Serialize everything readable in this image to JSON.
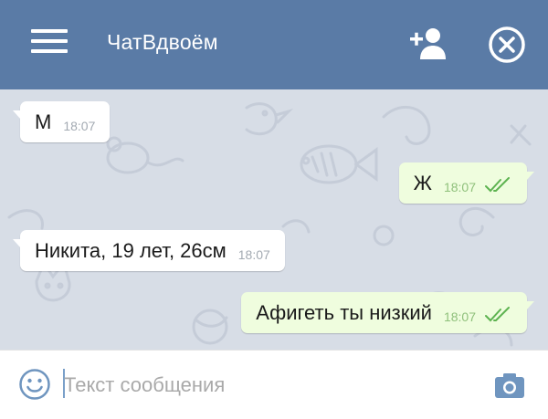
{
  "header": {
    "title": "ЧатВдвоём",
    "menu_icon": "hamburger-menu-icon",
    "add_user_icon": "add-user-icon",
    "close_icon": "close-circle-icon",
    "bg_color": "#5a7ba6"
  },
  "messages": [
    {
      "direction": "in",
      "text": "М",
      "time": "18:07"
    },
    {
      "direction": "out",
      "text": "Ж",
      "time": "18:07",
      "status": "read"
    },
    {
      "direction": "in",
      "text": "Никита, 19 лет, 26см",
      "time": "18:07"
    },
    {
      "direction": "out",
      "text": "Афигеть ты низкий",
      "time": "18:07",
      "status": "read"
    }
  ],
  "input": {
    "placeholder": "Текст сообщения",
    "value": "",
    "emoji_icon": "emoji-smile-icon",
    "camera_icon": "camera-icon"
  },
  "colors": {
    "chat_bg": "#d7dde6",
    "incoming_bubble": "#ffffff",
    "outgoing_bubble": "#effdde",
    "read_check": "#5db350"
  }
}
